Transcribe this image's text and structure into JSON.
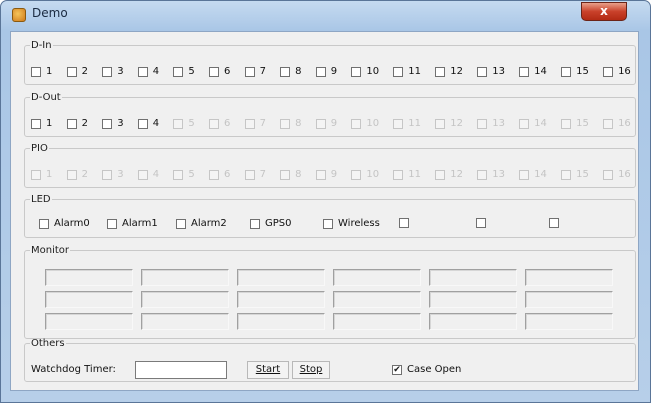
{
  "window": {
    "title": "Demo",
    "close_glyph": "x",
    "app_icon": "app-icon"
  },
  "din": {
    "legend": "D-In",
    "items": [
      {
        "label": "1",
        "checked": false,
        "enabled": true
      },
      {
        "label": "2",
        "checked": false,
        "enabled": true
      },
      {
        "label": "3",
        "checked": false,
        "enabled": true
      },
      {
        "label": "4",
        "checked": false,
        "enabled": true
      },
      {
        "label": "5",
        "checked": false,
        "enabled": true
      },
      {
        "label": "6",
        "checked": false,
        "enabled": true
      },
      {
        "label": "7",
        "checked": false,
        "enabled": true
      },
      {
        "label": "8",
        "checked": false,
        "enabled": true
      },
      {
        "label": "9",
        "checked": false,
        "enabled": true
      },
      {
        "label": "10",
        "checked": false,
        "enabled": true
      },
      {
        "label": "11",
        "checked": false,
        "enabled": true
      },
      {
        "label": "12",
        "checked": false,
        "enabled": true
      },
      {
        "label": "13",
        "checked": false,
        "enabled": true
      },
      {
        "label": "14",
        "checked": false,
        "enabled": true
      },
      {
        "label": "15",
        "checked": false,
        "enabled": true
      },
      {
        "label": "16",
        "checked": false,
        "enabled": true
      }
    ]
  },
  "dout": {
    "legend": "D-Out",
    "items": [
      {
        "label": "1",
        "checked": false,
        "enabled": true
      },
      {
        "label": "2",
        "checked": false,
        "enabled": true
      },
      {
        "label": "3",
        "checked": false,
        "enabled": true
      },
      {
        "label": "4",
        "checked": false,
        "enabled": true
      },
      {
        "label": "5",
        "checked": false,
        "enabled": false
      },
      {
        "label": "6",
        "checked": false,
        "enabled": false
      },
      {
        "label": "7",
        "checked": false,
        "enabled": false
      },
      {
        "label": "8",
        "checked": false,
        "enabled": false
      },
      {
        "label": "9",
        "checked": false,
        "enabled": false
      },
      {
        "label": "10",
        "checked": false,
        "enabled": false
      },
      {
        "label": "11",
        "checked": false,
        "enabled": false
      },
      {
        "label": "12",
        "checked": false,
        "enabled": false
      },
      {
        "label": "13",
        "checked": false,
        "enabled": false
      },
      {
        "label": "14",
        "checked": false,
        "enabled": false
      },
      {
        "label": "15",
        "checked": false,
        "enabled": false
      },
      {
        "label": "16",
        "checked": false,
        "enabled": false
      }
    ]
  },
  "pio": {
    "legend": "PIO",
    "items": [
      {
        "label": "1",
        "checked": false,
        "enabled": false
      },
      {
        "label": "2",
        "checked": false,
        "enabled": false
      },
      {
        "label": "3",
        "checked": false,
        "enabled": false
      },
      {
        "label": "4",
        "checked": false,
        "enabled": false
      },
      {
        "label": "5",
        "checked": false,
        "enabled": false
      },
      {
        "label": "6",
        "checked": false,
        "enabled": false
      },
      {
        "label": "7",
        "checked": false,
        "enabled": false
      },
      {
        "label": "8",
        "checked": false,
        "enabled": false
      },
      {
        "label": "9",
        "checked": false,
        "enabled": false
      },
      {
        "label": "10",
        "checked": false,
        "enabled": false
      },
      {
        "label": "11",
        "checked": false,
        "enabled": false
      },
      {
        "label": "12",
        "checked": false,
        "enabled": false
      },
      {
        "label": "13",
        "checked": false,
        "enabled": false
      },
      {
        "label": "14",
        "checked": false,
        "enabled": false
      },
      {
        "label": "15",
        "checked": false,
        "enabled": false
      },
      {
        "label": "16",
        "checked": false,
        "enabled": false
      }
    ]
  },
  "led": {
    "legend": "LED",
    "items": [
      {
        "label": "Alarm0",
        "checked": false,
        "enabled": true
      },
      {
        "label": "Alarm1",
        "checked": false,
        "enabled": true
      },
      {
        "label": "Alarm2",
        "checked": false,
        "enabled": true
      },
      {
        "label": "GPS0",
        "checked": false,
        "enabled": true
      },
      {
        "label": "Wireless",
        "checked": false,
        "enabled": true
      },
      {
        "label": "",
        "checked": false,
        "enabled": true
      },
      {
        "label": "",
        "checked": false,
        "enabled": true
      },
      {
        "label": "",
        "checked": false,
        "enabled": true
      }
    ]
  },
  "monitor": {
    "legend": "Monitor",
    "rows": 3,
    "cols": 6
  },
  "others": {
    "legend": "Others",
    "watchdog_label": "Watchdog Timer:",
    "watchdog_value": "",
    "start_label": "Start",
    "stop_label": "Stop",
    "case_open_label": "Case Open",
    "case_open_checked": true
  }
}
